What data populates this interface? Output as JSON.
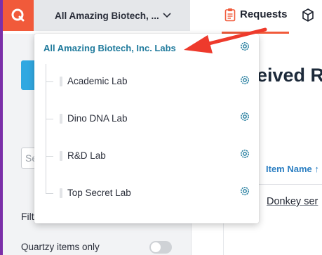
{
  "app": {
    "logo_letter": "Q",
    "org_selector": {
      "label": "All Amazing Biotech, ...",
      "chevron_icon": "chevron-down-icon"
    },
    "tabs": [
      {
        "label": "Requests",
        "icon": "clipboard-icon",
        "active": true
      },
      {
        "label": "",
        "icon": "box-icon",
        "active": false
      }
    ]
  },
  "sidebar": {
    "search_placeholder_fragment": "Se",
    "filter_fragment": "Filte",
    "quartzy_toggle": {
      "label": "Quartzy items only",
      "on": false
    }
  },
  "main": {
    "heading_fragment": "eived R",
    "column_header": "Item Name ↑",
    "first_row_item": "Donkey ser"
  },
  "dropdown": {
    "org": {
      "label": "All Amazing Biotech, Inc. Labs",
      "icon": "gear-icon"
    },
    "labs": [
      {
        "label": "Academic Lab",
        "icon": "gear-icon"
      },
      {
        "label": "Dino DNA Lab",
        "icon": "gear-icon"
      },
      {
        "label": "R&D Lab",
        "icon": "gear-icon"
      },
      {
        "label": "Top Secret Lab",
        "icon": "gear-icon"
      }
    ]
  },
  "colors": {
    "brand": "#f15a3a",
    "accent_purple": "#7b2fa8",
    "org_text": "#1f7a9c",
    "link_blue": "#2c7fc2",
    "annotation_arrow": "#ee3a2c"
  }
}
